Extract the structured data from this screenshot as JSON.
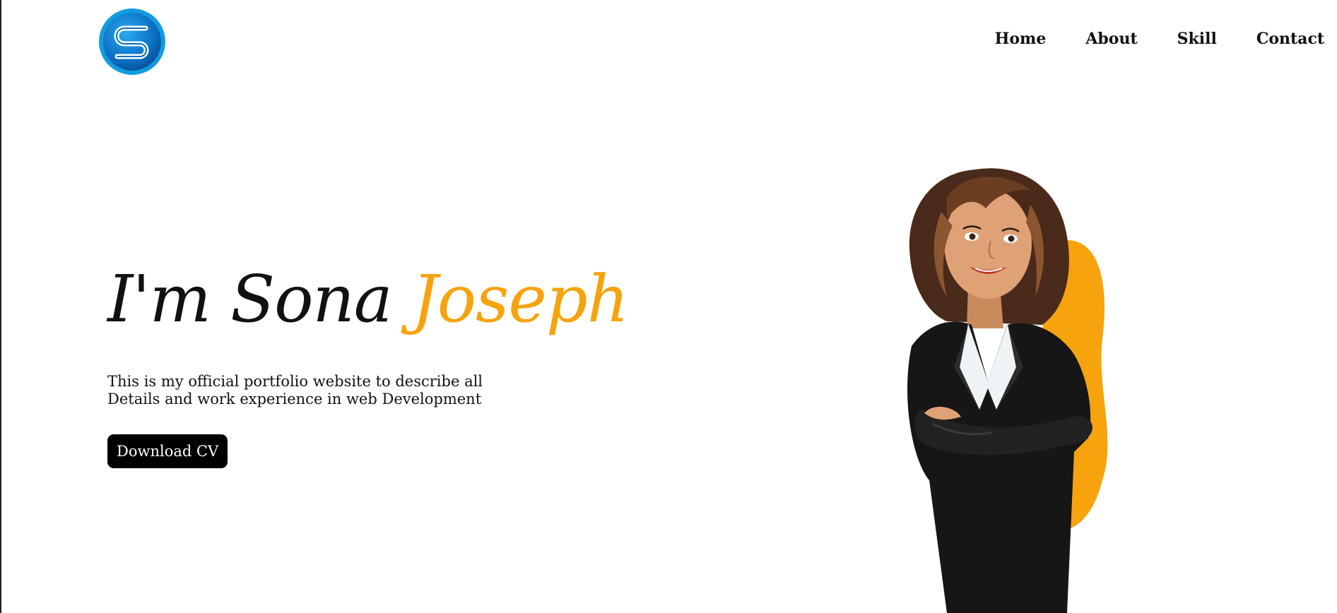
{
  "nav": {
    "items": [
      {
        "label": "Home"
      },
      {
        "label": "About"
      },
      {
        "label": "Skill"
      },
      {
        "label": "Contact"
      }
    ]
  },
  "logo": {
    "icon": "s-logo-icon",
    "color": "#0a7fd6"
  },
  "hero": {
    "title_first": "I'm Sona",
    "title_accent": "Joseph",
    "description": "This is my official portfolio website to describe all Details and work experience in web Development",
    "button_label": "Download CV"
  },
  "illustration": {
    "icon": "businesswoman-illustration",
    "accent_color": "#f7a30d"
  }
}
